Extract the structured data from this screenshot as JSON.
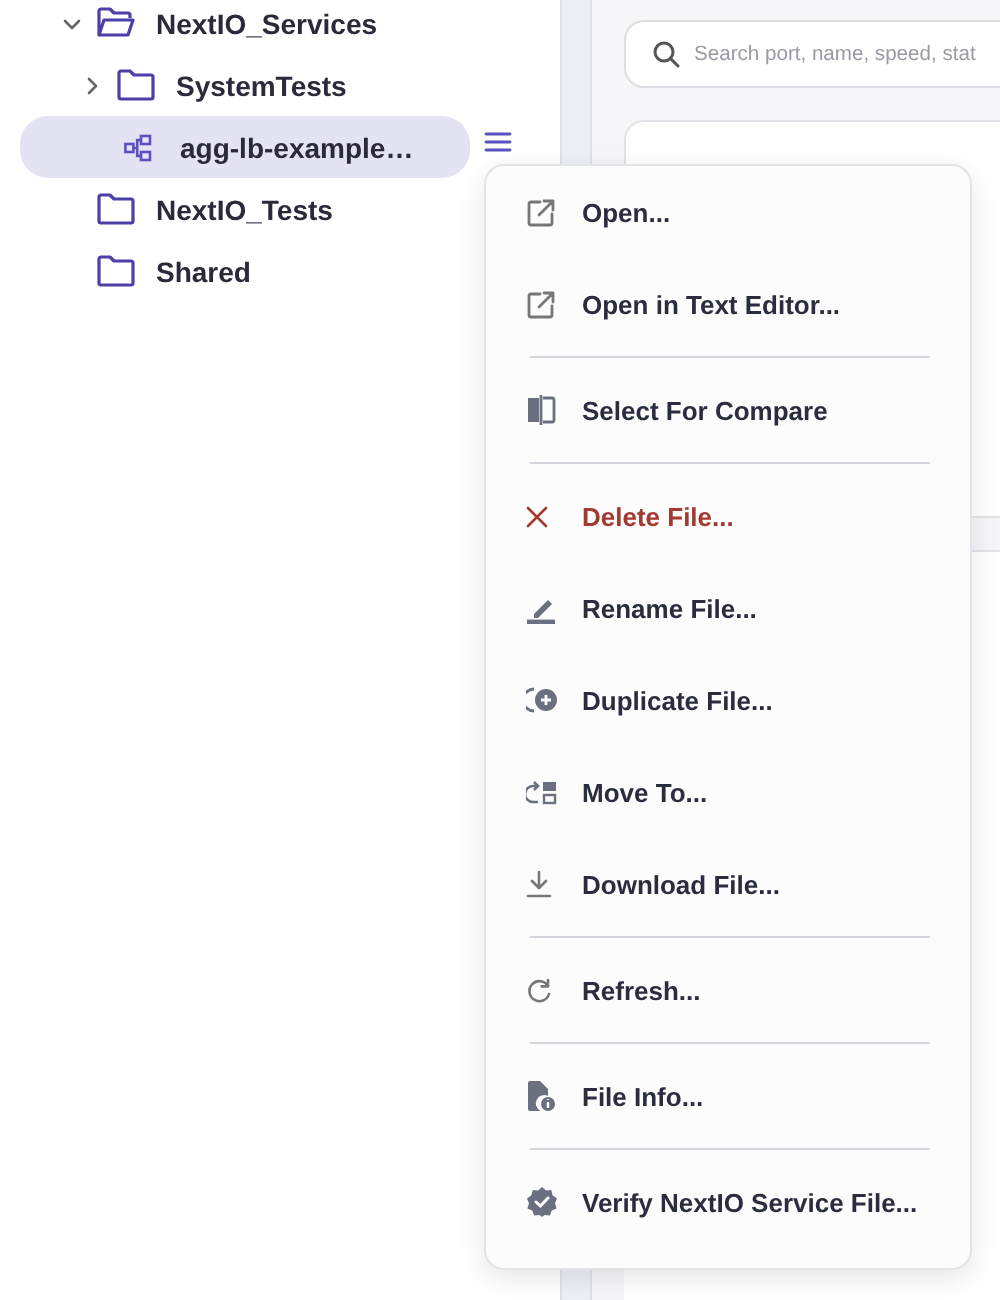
{
  "tree": [
    {
      "label": "NextIO_Services",
      "kind": "folder",
      "expanded": true,
      "selected": false,
      "children": [
        {
          "label": "SystemTests",
          "kind": "folder",
          "expanded": false,
          "selected": false
        },
        {
          "label": "agg-lb-example…",
          "kind": "file",
          "selected": true
        }
      ]
    },
    {
      "label": "NextIO_Tests",
      "kind": "folder",
      "selected": false
    },
    {
      "label": "Shared",
      "kind": "folder",
      "selected": false
    }
  ],
  "search": {
    "placeholder": "Search port, name, speed, stat"
  },
  "context_menu": {
    "groups": [
      [
        {
          "label": "Open...",
          "danger": false
        },
        {
          "label": "Open in Text Editor...",
          "danger": false
        }
      ],
      [
        {
          "label": "Select For Compare",
          "danger": false
        }
      ],
      [
        {
          "label": "Delete File...",
          "danger": true
        },
        {
          "label": "Rename File...",
          "danger": false
        },
        {
          "label": "Duplicate File...",
          "danger": false
        },
        {
          "label": "Move To...",
          "danger": false
        },
        {
          "label": "Download File...",
          "danger": false
        }
      ],
      [
        {
          "label": "Refresh...",
          "danger": false
        }
      ],
      [
        {
          "label": "File Info...",
          "danger": false
        }
      ],
      [
        {
          "label": "Verify NextIO Service File...",
          "danger": false
        }
      ]
    ]
  }
}
